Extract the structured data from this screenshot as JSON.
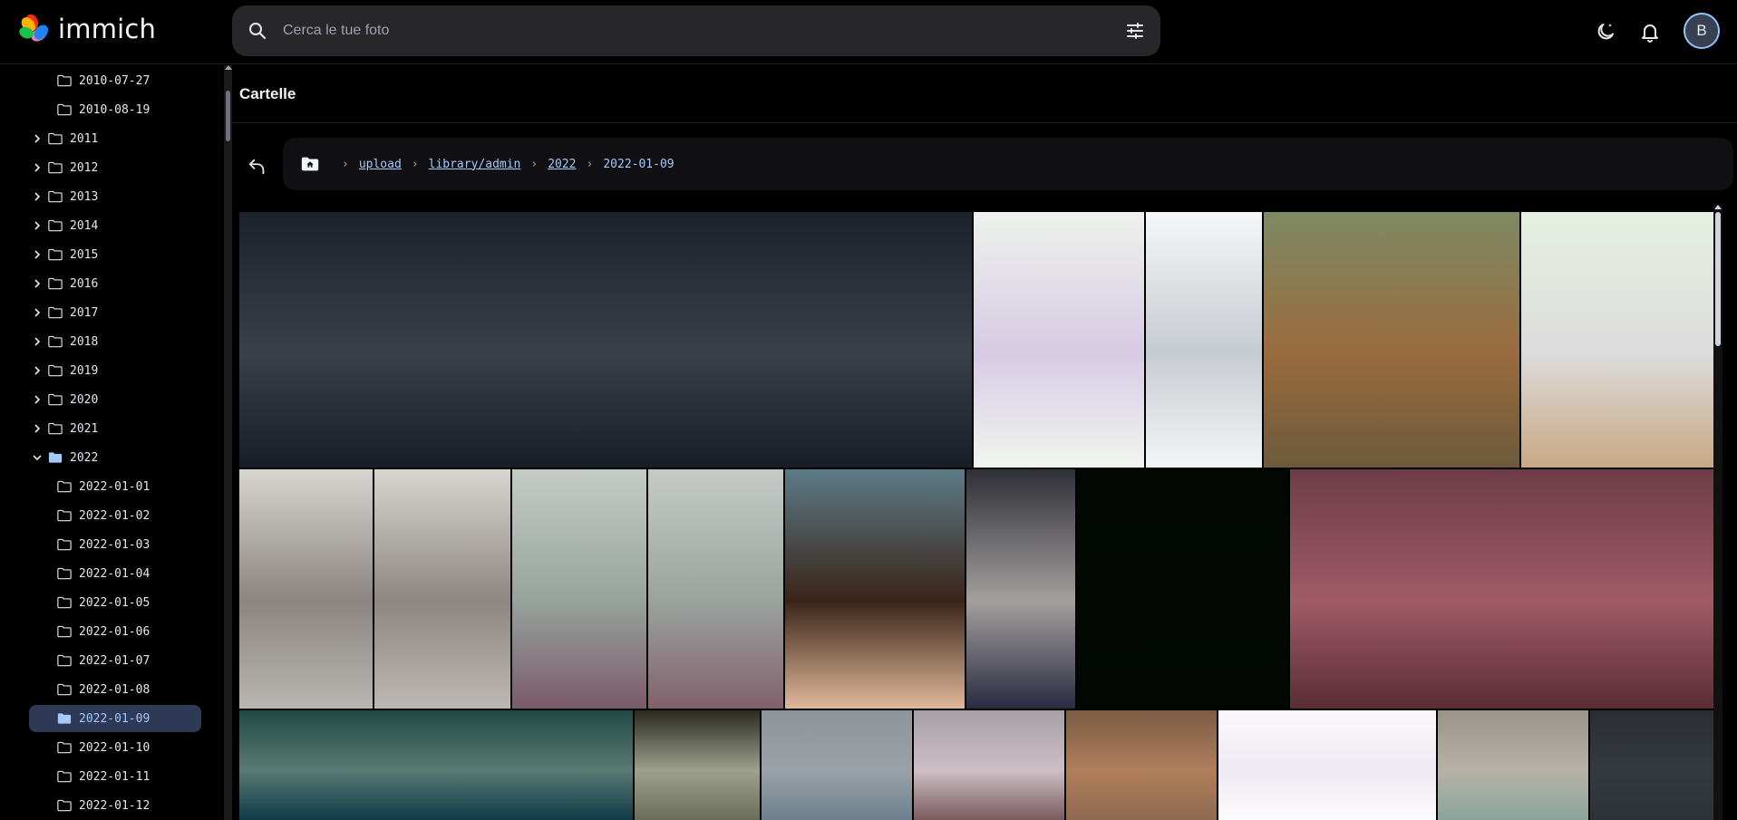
{
  "app": {
    "name": "immich"
  },
  "search": {
    "placeholder": "Cerca le tue foto"
  },
  "header": {
    "avatar_initial": "B"
  },
  "page": {
    "title": "Cartelle"
  },
  "sidebar": {
    "items": [
      {
        "label": "2010-07-27",
        "level": 2,
        "expandable": false,
        "open": false,
        "selected": false
      },
      {
        "label": "2010-08-19",
        "level": 2,
        "expandable": false,
        "open": false,
        "selected": false
      },
      {
        "label": "2011",
        "level": 1,
        "expandable": true,
        "open": false,
        "selected": false
      },
      {
        "label": "2012",
        "level": 1,
        "expandable": true,
        "open": false,
        "selected": false
      },
      {
        "label": "2013",
        "level": 1,
        "expandable": true,
        "open": false,
        "selected": false
      },
      {
        "label": "2014",
        "level": 1,
        "expandable": true,
        "open": false,
        "selected": false
      },
      {
        "label": "2015",
        "level": 1,
        "expandable": true,
        "open": false,
        "selected": false
      },
      {
        "label": "2016",
        "level": 1,
        "expandable": true,
        "open": false,
        "selected": false
      },
      {
        "label": "2017",
        "level": 1,
        "expandable": true,
        "open": false,
        "selected": false
      },
      {
        "label": "2018",
        "level": 1,
        "expandable": true,
        "open": false,
        "selected": false
      },
      {
        "label": "2019",
        "level": 1,
        "expandable": true,
        "open": false,
        "selected": false
      },
      {
        "label": "2020",
        "level": 1,
        "expandable": true,
        "open": false,
        "selected": false
      },
      {
        "label": "2021",
        "level": 1,
        "expandable": true,
        "open": false,
        "selected": false
      },
      {
        "label": "2022",
        "level": 1,
        "expandable": true,
        "open": true,
        "selected": false
      },
      {
        "label": "2022-01-01",
        "level": 2,
        "expandable": false,
        "open": false,
        "selected": false
      },
      {
        "label": "2022-01-02",
        "level": 2,
        "expandable": false,
        "open": false,
        "selected": false
      },
      {
        "label": "2022-01-03",
        "level": 2,
        "expandable": false,
        "open": false,
        "selected": false
      },
      {
        "label": "2022-01-04",
        "level": 2,
        "expandable": false,
        "open": false,
        "selected": false
      },
      {
        "label": "2022-01-05",
        "level": 2,
        "expandable": false,
        "open": false,
        "selected": false
      },
      {
        "label": "2022-01-06",
        "level": 2,
        "expandable": false,
        "open": false,
        "selected": false
      },
      {
        "label": "2022-01-07",
        "level": 2,
        "expandable": false,
        "open": false,
        "selected": false
      },
      {
        "label": "2022-01-08",
        "level": 2,
        "expandable": false,
        "open": false,
        "selected": false
      },
      {
        "label": "2022-01-09",
        "level": 2,
        "expandable": false,
        "open": false,
        "selected": true
      },
      {
        "label": "2022-01-10",
        "level": 2,
        "expandable": false,
        "open": false,
        "selected": false
      },
      {
        "label": "2022-01-11",
        "level": 2,
        "expandable": false,
        "open": false,
        "selected": false
      },
      {
        "label": "2022-01-12",
        "level": 2,
        "expandable": false,
        "open": false,
        "selected": false
      }
    ]
  },
  "breadcrumb": {
    "links": [
      "upload",
      "library/admin",
      "2022"
    ],
    "current": "2022-01-09"
  },
  "colors": {
    "accent": "#a5c8ff",
    "selected_bg": "#2e3a55",
    "search_bg": "#27272a",
    "breadcrumb_bg": "#101012"
  },
  "icons": {
    "logo": "immich-pinwheel-icon",
    "search": "search-icon",
    "filter": "tune-icon",
    "theme": "moon-icon",
    "notifications": "bell-icon",
    "back": "arrow-up-left-icon",
    "home": "folder-home-icon",
    "folder": "folder-outline-icon",
    "folder_open": "folder-filled-icon",
    "chevron": "chevron-icon"
  },
  "gallery": {
    "photo_colors": [
      [
        "#1c222c",
        "#3a3f48",
        "#181d26"
      ],
      [
        "#eef2ec",
        "#d7cbe4",
        "#f1f5ef"
      ],
      [
        "#f5f7f8",
        "#c7ccd1",
        "#f3f5f7"
      ],
      [
        "#7d8a63",
        "#9a6b3e",
        "#6d5a3b"
      ],
      [
        "#e6efe1",
        "#dcdcdc",
        "#c9a884"
      ],
      [
        "#d8d4d0",
        "#8a8580",
        "#bab6b2"
      ],
      [
        "#d9d5d0",
        "#8c8782",
        "#bdb8b4"
      ],
      [
        "#c5ccc7",
        "#97a39c",
        "#7b5a6a"
      ],
      [
        "#c6cbc7",
        "#9ba39f",
        "#81606c"
      ],
      [
        "#5c7b88",
        "#3a2418",
        "#e0b89a"
      ],
      [
        "#2f2f37",
        "#a3a09e",
        "#2b2b40"
      ],
      [
        "#020702",
        "#030803",
        "#020702"
      ],
      [
        "#6e3d47",
        "#a05a68",
        "#5a2d35"
      ],
      [
        "#224a44",
        "#5a7a72",
        "#0f3a48"
      ],
      [
        "#2a2a22",
        "#9ea18c",
        "#6a6d5a"
      ],
      [
        "#8e949a",
        "#9aa2a8",
        "#6d7f8c"
      ],
      [
        "#a8a0a6",
        "#cbbfc5",
        "#7a5a5e"
      ],
      [
        "#7a5c45",
        "#b07e5a",
        "#8e6a50"
      ],
      [
        "#fbf9fc",
        "#efe9f1",
        "#fcfbfd"
      ],
      [
        "#9a938a",
        "#b7b2a8",
        "#8aa49c"
      ],
      [
        "#2a2e33",
        "#353a40",
        "#2d3237"
      ]
    ]
  }
}
